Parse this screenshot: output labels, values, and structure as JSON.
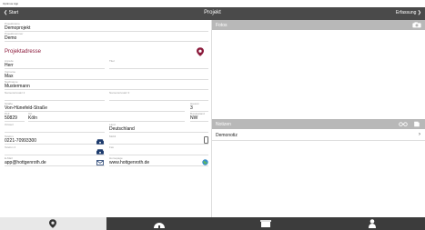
{
  "window": {
    "title": "Optimus App"
  },
  "nav": {
    "back_label": "Start",
    "title": "Projekt",
    "action_label": "Erfassung"
  },
  "project": {
    "name_label": "Projektname",
    "name_value": "Demoprojekt",
    "number_label": "Projektnummer",
    "number_value": "Demo"
  },
  "section": {
    "address_title": "Projektadresse"
  },
  "address": {
    "anrede_label": "Anrede",
    "anrede_value": "Herr",
    "titel_label": "Titel",
    "titel_value": "",
    "vorname_label": "Vorname",
    "vorname_value": "Max",
    "nachname_label": "Nachname",
    "nachname_value": "Mustermann",
    "namenszusatz2_label": "Namenszusatz 2",
    "namenszusatz2_value": "",
    "namenszusatz3_label": "Namenszusatz 3",
    "namenszusatz3_value": "",
    "strasse_label": "Straße",
    "strasse_value": "Von-Hünefeld-Straße",
    "hausnr_label": "Hausnr.",
    "hausnr_value": "3",
    "plz_label": "PLZ",
    "plz_value": "50829",
    "ort_label": "Ort",
    "ort_value": "Köln",
    "bundesland_label": "Bundesland",
    "bundesland_value": "NW",
    "ortsteil_label": "Ortsteil",
    "ortsteil_value": "",
    "land_label": "Land",
    "land_value": "Deutschland",
    "telefon_label": "Telefon",
    "telefon_value": "0221-70993300",
    "mobil_label": "Mobil",
    "mobil_value": "",
    "telefon2_label": "Telefon 2",
    "telefon2_value": "",
    "fax_label": "Fax",
    "fax_value": "",
    "email_label": "E-Mail",
    "email_value": "app@hottgenroth.de",
    "homepage_label": "Homepage",
    "homepage_value": "www.hottgenroth.de"
  },
  "right": {
    "fotos_title": "Fotos",
    "notizen_title": "Notizen",
    "notes": [
      {
        "label": "Demonotiz"
      }
    ]
  },
  "tabs": [
    {
      "name": "location",
      "icon": "map-pin-icon",
      "active": true
    },
    {
      "name": "building",
      "icon": "igloo-icon",
      "active": false
    },
    {
      "name": "package",
      "icon": "box-icon",
      "active": false
    },
    {
      "name": "person",
      "icon": "person-icon",
      "active": false
    }
  ],
  "colors": {
    "accent": "#8b1a3b",
    "navbar": "#4a4a4a",
    "tabbar": "#3c3c3c",
    "header": "#b8b8b8"
  }
}
